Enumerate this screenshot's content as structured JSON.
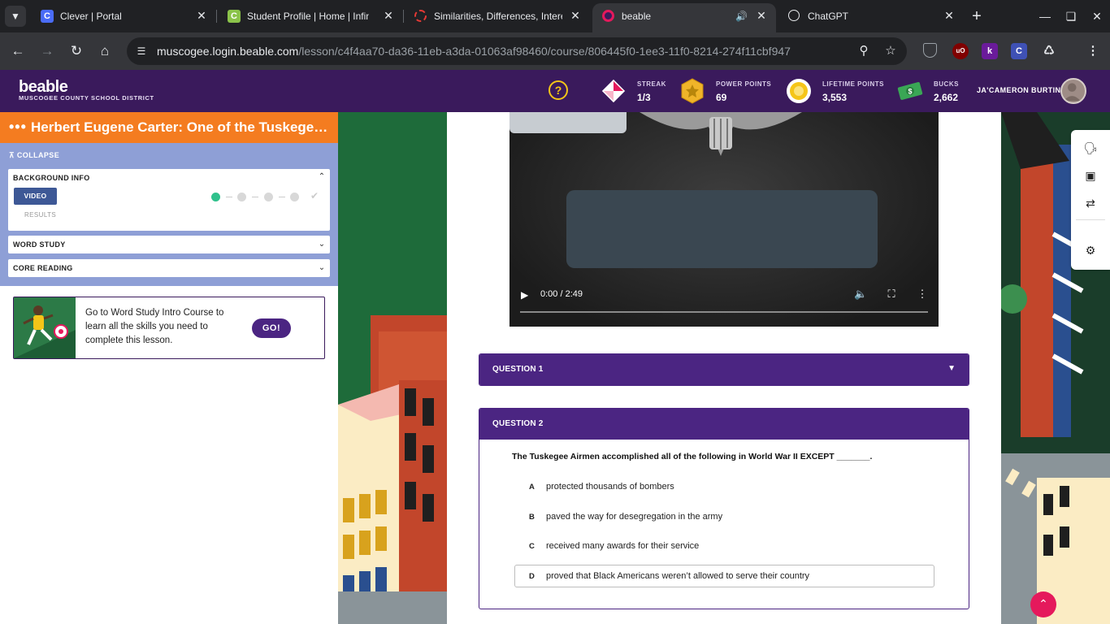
{
  "browser": {
    "tabs": [
      {
        "title": "Clever | Portal",
        "icon": "clever-favicon",
        "icon_letter": "C",
        "color": "#4a6cf7"
      },
      {
        "title": "Student Profile | Home | Infini",
        "icon": "infinite-campus-favicon",
        "icon_letter": "C",
        "color": "#8bc34a"
      },
      {
        "title": "Similarities, Differences, Intere",
        "icon": "loading-spinner-icon",
        "icon_letter": "",
        "color": "#e53935"
      },
      {
        "title": "beable",
        "icon": "beable-favicon",
        "icon_letter": "",
        "color": "#e5195c"
      },
      {
        "title": "ChatGPT",
        "icon": "chatgpt-favicon",
        "icon_letter": "",
        "color": "#e8eaed"
      }
    ],
    "url_host": "muscogee.login.beable.com",
    "url_path": "/lesson/c4f4aa70-da36-11eb-a3da-01063af98460/course/806445f0-1ee3-11f0-8214-274f11cbf947",
    "extensions": [
      {
        "name": "shield-extension-icon",
        "letter": "",
        "color": "#35363a"
      },
      {
        "name": "ublock-extension-icon",
        "letter": "uO",
        "color": "#800000"
      },
      {
        "name": "kami-extension-icon",
        "letter": "k",
        "color": "#6a1b9a"
      },
      {
        "name": "clever-extension-icon",
        "letter": "C",
        "color": "#3f51b5"
      }
    ]
  },
  "header": {
    "logo": "beable",
    "district": "MUSCOGEE COUNTY SCHOOL DISTRICT",
    "stats": [
      {
        "label": "STREAK",
        "value": "1/3",
        "icon": "streak-icon"
      },
      {
        "label": "POWER POINTS",
        "value": "69",
        "icon": "power-points-icon"
      },
      {
        "label": "LIFETIME POINTS",
        "value": "3,553",
        "icon": "lifetime-points-icon"
      },
      {
        "label": "BUCKS",
        "value": "2,662",
        "icon": "bucks-icon"
      }
    ],
    "user_name": "JA'CAMERON BURTIN"
  },
  "lesson": {
    "title": "Herbert Eugene Carter: One of the Tuskegee Airmen",
    "collapse_label": "COLLAPSE",
    "sections": [
      {
        "title": "BACKGROUND INFO",
        "expanded": true
      },
      {
        "title": "WORD STUDY",
        "expanded": false
      },
      {
        "title": "CORE READING",
        "expanded": false
      }
    ],
    "video_label": "VIDEO",
    "results_label": "RESULTS",
    "progress_steps_done": 1,
    "progress_steps_total": 4
  },
  "promo": {
    "text": "Go to Word Study Intro Course to learn all the skills you need to complete this lesson.",
    "button": "GO!"
  },
  "video": {
    "time": "0:00 / 2:49"
  },
  "questions": [
    {
      "label": "QUESTION 1",
      "expanded": false
    },
    {
      "label": "QUESTION 2",
      "expanded": true,
      "prompt": "The Tuskegee Airmen accomplished all of the following in World War II EXCEPT _______.",
      "choices": [
        {
          "letter": "A",
          "text": "protected thousands of bombers"
        },
        {
          "letter": "B",
          "text": "paved the way for desegregation in the army"
        },
        {
          "letter": "C",
          "text": "received many awards for their service"
        },
        {
          "letter": "D",
          "text": "proved that Black Americans weren’t allowed to serve their country"
        }
      ],
      "selected": "D"
    }
  ],
  "colors": {
    "header_bg": "#3a1a5c",
    "lesson_bar": "#f47c20",
    "steps_panel": "#8e9fd6",
    "question_purple": "#4b2582",
    "accent_pink": "#e5195c"
  }
}
